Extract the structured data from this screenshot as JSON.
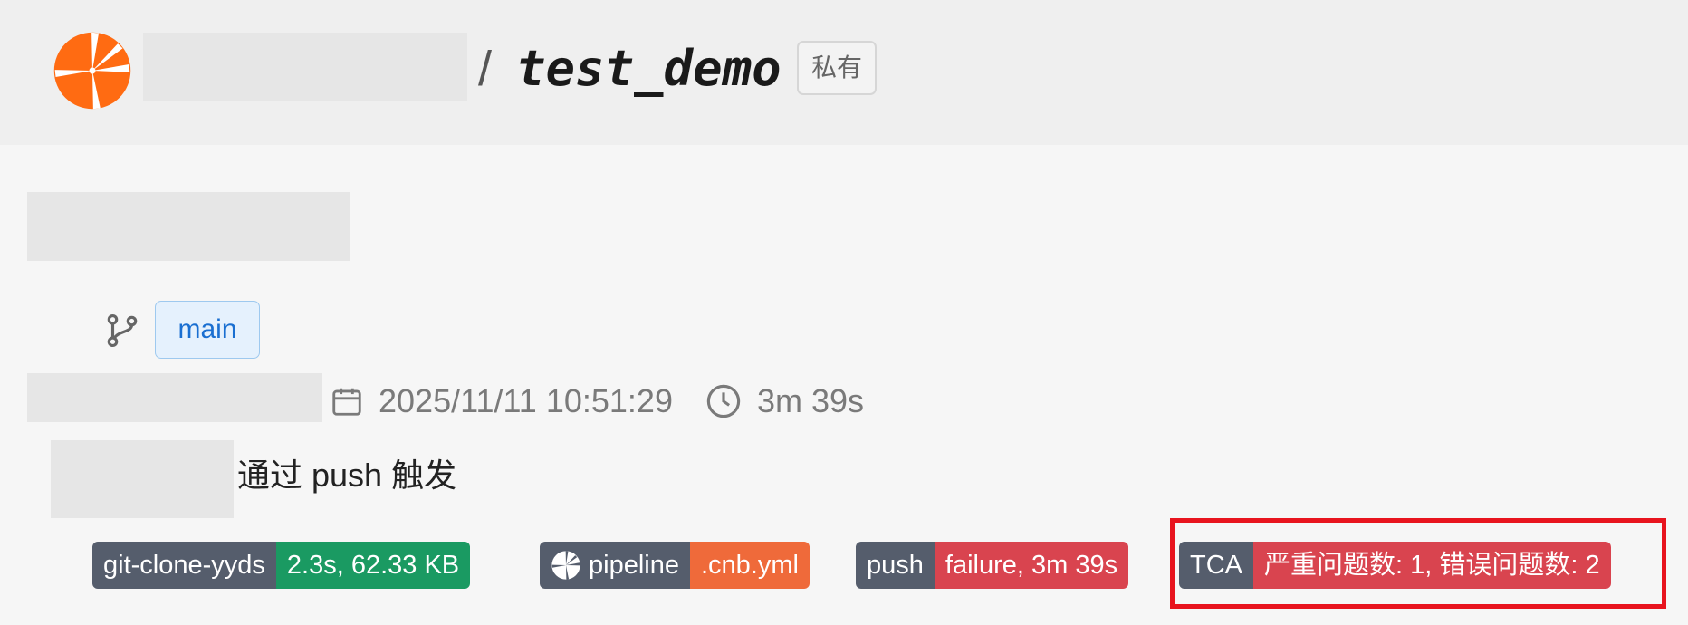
{
  "header": {
    "owner_redacted": true,
    "separator": "/",
    "repo_name": "test_demo",
    "visibility_badge": "私有"
  },
  "build": {
    "title_redacted": true,
    "branch": "main",
    "author_redacted": true,
    "date": "2025/11/11 10:51:29",
    "duration": "3m 39s",
    "trigger_user_redacted": true,
    "trigger_text": "通过 push 触发"
  },
  "badges": [
    {
      "name": "git-clone-yyds",
      "value": "2.3s, 62.33 KB",
      "color": "#1a9a62"
    },
    {
      "name": "pipeline",
      "value": ".cnb.yml",
      "color": "#ef6a3a",
      "icon": "pinwheel-icon"
    },
    {
      "name": "push",
      "value": "failure, 3m 39s",
      "color": "#d9444f"
    },
    {
      "name": "TCA",
      "value": "严重问题数: 1, 错误问题数: 2",
      "color": "#d9444f"
    }
  ],
  "colors": {
    "brand": "#ff6b12",
    "badge_label_bg": "#555d6c",
    "highlight": "#e8141e"
  }
}
